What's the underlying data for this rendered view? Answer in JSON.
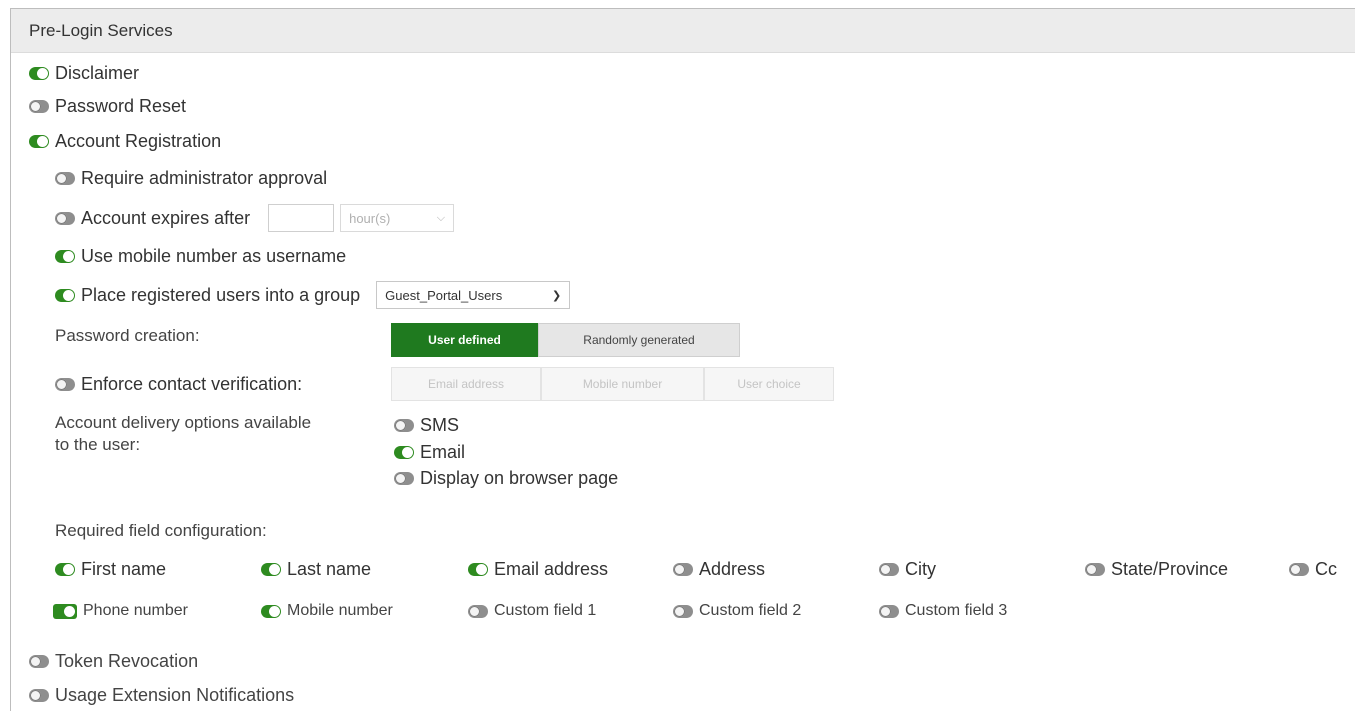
{
  "header": {
    "title": "Pre-Login Services"
  },
  "services": {
    "disclaimer": {
      "label": "Disclaimer",
      "on": true
    },
    "password_reset": {
      "label": "Password Reset",
      "on": false
    },
    "account_registration": {
      "label": "Account Registration",
      "on": true
    },
    "token_revocation": {
      "label": "Token Revocation",
      "on": false
    },
    "usage_extension": {
      "label": "Usage Extension Notifications",
      "on": false
    }
  },
  "registration": {
    "require_admin": {
      "label": "Require administrator approval",
      "on": false
    },
    "account_expires": {
      "label": "Account expires after",
      "on": false,
      "value": "",
      "unit": "hour(s)"
    },
    "mobile_username": {
      "label": "Use mobile number as username",
      "on": true
    },
    "place_group": {
      "label": "Place registered users into a group",
      "on": true,
      "group": "Guest_Portal_Users"
    },
    "password_creation": {
      "label": "Password creation:",
      "options": [
        "User defined",
        "Randomly generated"
      ],
      "selected": "User defined"
    },
    "contact_verification": {
      "label": "Enforce contact verification:",
      "on": false,
      "options": [
        "Email address",
        "Mobile number",
        "User choice"
      ]
    },
    "delivery": {
      "label_line1": "Account delivery options available",
      "label_line2": "to the user:",
      "sms": {
        "label": "SMS",
        "on": false
      },
      "email": {
        "label": "Email",
        "on": true
      },
      "browser": {
        "label": "Display on browser page",
        "on": false
      }
    },
    "required_fields": {
      "label": "Required field configuration:",
      "first_name": {
        "label": "First name",
        "on": true
      },
      "last_name": {
        "label": "Last name",
        "on": true
      },
      "email_address": {
        "label": "Email address",
        "on": true
      },
      "address": {
        "label": "Address",
        "on": false
      },
      "city": {
        "label": "City",
        "on": false
      },
      "state": {
        "label": "State/Province",
        "on": false
      },
      "country": {
        "label": "Cc",
        "on": false
      },
      "phone_number": {
        "label": "Phone number",
        "on": true
      },
      "mobile_number": {
        "label": "Mobile number",
        "on": true
      },
      "custom1": {
        "label": "Custom field 1",
        "on": false
      },
      "custom2": {
        "label": "Custom field 2",
        "on": false
      },
      "custom3": {
        "label": "Custom field 3",
        "on": false
      }
    }
  },
  "colors": {
    "toggle_on": "#2e8b20",
    "toggle_off": "#8e8e8e",
    "active_segment": "#1f7a1f",
    "header_bg": "#ececec"
  }
}
